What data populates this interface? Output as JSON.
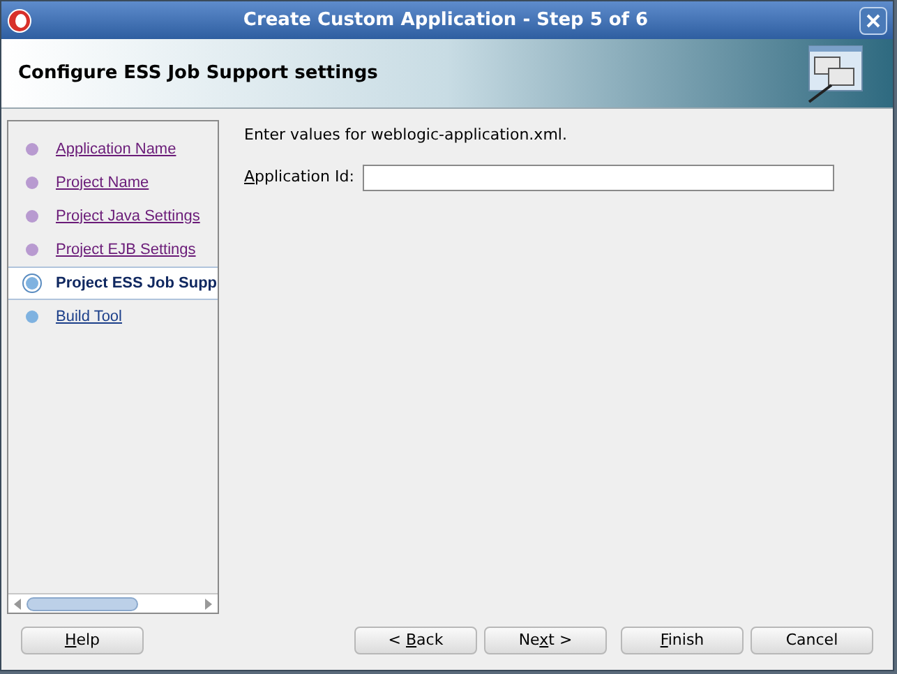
{
  "window": {
    "title": "Create Custom Application - Step 5 of 6"
  },
  "header": {
    "title": "Configure ESS Job Support settings"
  },
  "steps": [
    {
      "label": "Application Name",
      "kind": "visited",
      "selected": false
    },
    {
      "label": "Project Name",
      "kind": "visited",
      "selected": false
    },
    {
      "label": "Project Java Settings",
      "kind": "visited",
      "selected": false
    },
    {
      "label": "Project EJB Settings",
      "kind": "visited",
      "selected": false
    },
    {
      "label": "Project ESS Job Supp",
      "kind": "current",
      "selected": true
    },
    {
      "label": "Build Tool",
      "kind": "pending",
      "selected": false
    }
  ],
  "content": {
    "instruction": "Enter values for weblogic-application.xml.",
    "field": {
      "label": {
        "key": "A",
        "after": "pplication Id:"
      }
    }
  },
  "help_button": {
    "label": {
      "key": "H",
      "after": "elp"
    }
  },
  "buttons": [
    {
      "label": {
        "before": "< ",
        "key": "B",
        "after": "ack"
      }
    },
    {
      "label": {
        "before": "Ne",
        "key": "x",
        "after": "t >"
      }
    },
    {
      "label": {
        "key": "F",
        "after": "inish"
      }
    },
    {
      "label": {
        "after": "Cancel"
      }
    }
  ]
}
